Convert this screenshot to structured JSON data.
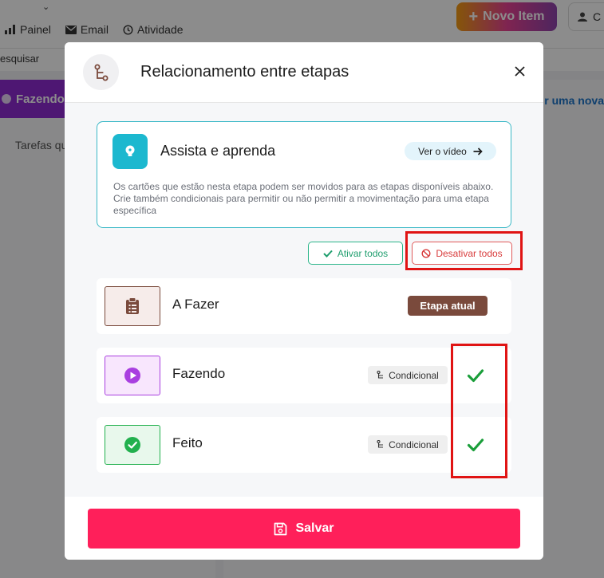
{
  "background": {
    "nav": [
      {
        "label": "Painel",
        "icon": "bar-chart-icon"
      },
      {
        "label": "Email",
        "icon": "envelope-icon"
      },
      {
        "label": "Atividade",
        "icon": "history-icon"
      }
    ],
    "search_label": "esquisar",
    "new_item_label": "Novo Item",
    "user_button_label": "C",
    "column_title": "Fazendo",
    "column_text": "Tarefas qu",
    "add_link": "r uma nova"
  },
  "modal": {
    "title": "Relacionamento entre etapas",
    "learn": {
      "title": "Assista e aprenda",
      "video_button": "Ver o vídeo",
      "description": "Os cartões que estão nesta etapa podem ser movidos para as etapas disponíveis abaixo. Crie também condicionais para permitir ou não permitir a movimentação para uma etapa específica"
    },
    "enable_all": "Ativar todos",
    "disable_all": "Desativar todos",
    "stages": [
      {
        "name": "A Fazer",
        "icon": "clipboard-icon",
        "badge": "Etapa atual",
        "color": "#7a4a3c"
      },
      {
        "name": "Fazendo",
        "icon": "play-icon",
        "conditional_label": "Condicional",
        "checked": true,
        "color": "#a93fe0"
      },
      {
        "name": "Feito",
        "icon": "check-circle-icon",
        "conditional_label": "Condicional",
        "checked": true,
        "color": "#22b04e"
      }
    ],
    "save_label": "Salvar"
  },
  "colors": {
    "accent_save": "#ff1f5a",
    "highlight": "#e01414",
    "check": "#1a9e3a"
  }
}
